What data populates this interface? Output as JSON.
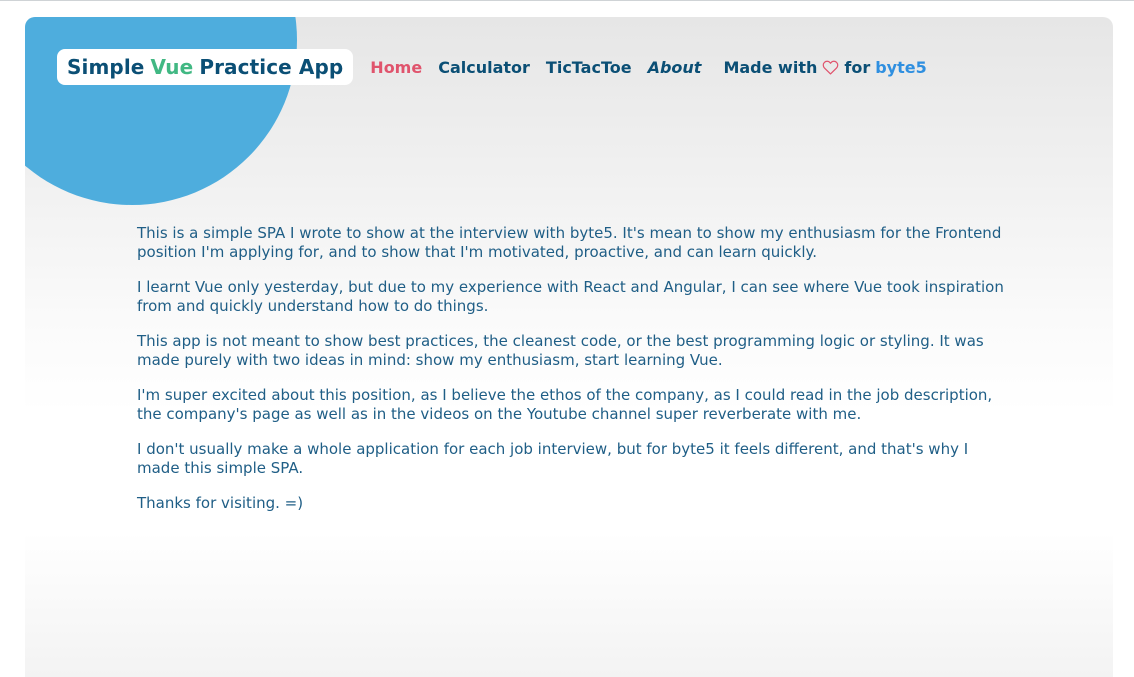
{
  "brand": {
    "part1": "Simple",
    "part2": "Vue",
    "part3": "Practice App"
  },
  "nav": {
    "items": [
      {
        "label": "Home",
        "active": true
      },
      {
        "label": "Calculator",
        "active": false
      },
      {
        "label": "TicTacToe",
        "active": false
      },
      {
        "label": "About",
        "active": false
      }
    ],
    "made_with": {
      "prefix": "Made with",
      "icon": "heart-icon",
      "middle": "for",
      "link": "byte5"
    }
  },
  "content": {
    "paragraphs": [
      "This is a simple SPA I wrote to show at the interview with byte5. It's mean to show my enthusiasm for the Frontend position I'm applying for, and to show that I'm motivated, proactive, and can learn quickly.",
      "I learnt Vue only yesterday, but due to my experience with React and Angular, I can see where Vue took inspiration from and quickly understand how to do things.",
      "This app is not meant to show best practices, the cleanest code, or the best programming logic or styling. It was made purely with two ideas in mind: show my enthusiasm, start learning Vue.",
      "I'm super excited about this position, as I believe the ethos of the company, as I could read in the job description, the company's page as well as in the videos on the Youtube channel super reverberate with me.",
      "I don't usually make a whole application for each job interview, but for byte5 it feels different, and that's why I made this simple SPA.",
      "Thanks for visiting. =)"
    ]
  },
  "colors": {
    "primary": "#0b4f75",
    "vue_green": "#41b883",
    "active_link": "#e0546d",
    "heart": "#e0546d",
    "link_blue": "#2f8fe0",
    "blob": "#4eaddd",
    "text": "#1f5e86"
  }
}
